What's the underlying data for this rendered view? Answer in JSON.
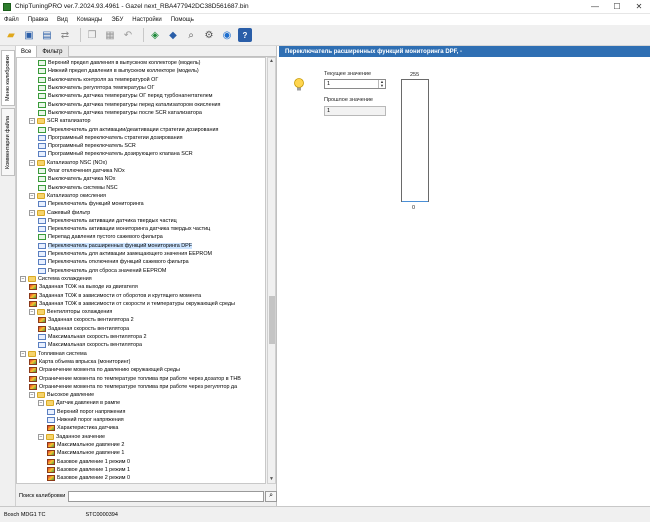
{
  "window": {
    "title": "ChipTuningPRO ver.7.2024.93.4961 - Gazel next_RBA477942DC38D561687.bin",
    "minimize": "—",
    "maximize": "☐",
    "close": "✕"
  },
  "menu": [
    "Файл",
    "Правка",
    "Вид",
    "Команды",
    "ЭБУ",
    "Настройки",
    "Помощь"
  ],
  "side_tabs": {
    "calibrations": "Меню калибровки",
    "comments": "Комментарии файла"
  },
  "left_tabs": [
    "Все",
    "Фильтр"
  ],
  "tree": [
    {
      "level": 2,
      "icon": "check",
      "label": "Верхний предел давления в выпускном коллекторе (модель)"
    },
    {
      "level": 2,
      "icon": "check",
      "label": "Нижний предел давления в выпускном коллекторе (модель)"
    },
    {
      "level": 2,
      "icon": "check",
      "label": "Выключатель контроля за температурой ОГ"
    },
    {
      "level": 2,
      "icon": "check",
      "label": "Выключатель регулятора температуры ОГ"
    },
    {
      "level": 2,
      "icon": "check",
      "label": "Выключатель датчика температуры ОГ перед турбонагнетателем"
    },
    {
      "level": 2,
      "icon": "check",
      "label": "Выключатель датчика температуры перед катализатором окисления"
    },
    {
      "level": 2,
      "icon": "check",
      "label": "Выключатель датчика температуры после SCR катализатора"
    },
    {
      "level": 1,
      "icon": "folder",
      "expander": "−",
      "label": "SCR катализатор"
    },
    {
      "level": 2,
      "icon": "check",
      "label": "Переключатель для активации/деактивации стратегии дозирования"
    },
    {
      "level": 2,
      "icon": "table",
      "label": "Программный переключатель стратегии дозирования"
    },
    {
      "level": 2,
      "icon": "table",
      "label": "Программный переключатель SCR"
    },
    {
      "level": 2,
      "icon": "table",
      "label": "Программный переключатель дозирующего клапана SCR"
    },
    {
      "level": 1,
      "icon": "folder",
      "expander": "−",
      "label": "Катализатор NSC (NOx)"
    },
    {
      "level": 2,
      "icon": "check",
      "label": "Флаг отключения датчика NOx"
    },
    {
      "level": 2,
      "icon": "check",
      "label": "Выключатель датчика NOx"
    },
    {
      "level": 2,
      "icon": "check",
      "label": "Выключатель системы NSC"
    },
    {
      "level": 1,
      "icon": "folder",
      "expander": "−",
      "label": "Катализатор окисления"
    },
    {
      "level": 2,
      "icon": "table",
      "label": "Переключатель функций мониторинга"
    },
    {
      "level": 1,
      "icon": "folder",
      "expander": "−",
      "label": "Сажевый фильтр"
    },
    {
      "level": 2,
      "icon": "table",
      "label": "Переключатель активации датчика твердых частиц"
    },
    {
      "level": 2,
      "icon": "table",
      "label": "Переключатель активации мониторинга датчика твердых частиц"
    },
    {
      "level": 2,
      "icon": "check",
      "label": "Перепад давления пустого сажевого фильтра"
    },
    {
      "level": 2,
      "icon": "table",
      "label": "Переключатель расширенных функций мониторинга DPF",
      "selected": true
    },
    {
      "level": 2,
      "icon": "table",
      "label": "Переключатель для активации замещающего значения EEPROM"
    },
    {
      "level": 2,
      "icon": "table",
      "label": "Переключатель отключения функций сажевого фильтра"
    },
    {
      "level": 2,
      "icon": "table",
      "label": "Переключатель для сброса значений EEPROM"
    },
    {
      "level": 0,
      "icon": "folder",
      "expander": "−",
      "label": "Система охлаждения"
    },
    {
      "level": 1,
      "icon": "map",
      "label": "Заданная ТОЖ на выходе из двигателя"
    },
    {
      "level": 1,
      "icon": "map",
      "label": "Заданная ТОЖ в зависимости от оборотов и крутящего момента"
    },
    {
      "level": 1,
      "icon": "map",
      "label": "Заданная ТОЖ в зависимости от скорости и температуры окружающей среды"
    },
    {
      "level": 1,
      "icon": "folder",
      "expander": "−",
      "label": "Вентиляторы охлаждения"
    },
    {
      "level": 2,
      "icon": "map",
      "label": "Заданная скорость вентилятора 2"
    },
    {
      "level": 2,
      "icon": "map",
      "label": "Заданная скорость вентилятора"
    },
    {
      "level": 2,
      "icon": "table",
      "label": "Максимальная скорость вентилятора 2"
    },
    {
      "level": 2,
      "icon": "table",
      "label": "Максимальная скорость вентилятора"
    },
    {
      "level": 0,
      "icon": "folder",
      "expander": "−",
      "label": "Топливная система"
    },
    {
      "level": 1,
      "icon": "map",
      "label": "Карта объема впрыска (мониторинг)"
    },
    {
      "level": 1,
      "icon": "map",
      "label": "Ограничение момента по давлению окружающей среды"
    },
    {
      "level": 1,
      "icon": "map",
      "label": "Ограничение момента по температуре топлива при работе через дозатор в ТНВ"
    },
    {
      "level": 1,
      "icon": "map",
      "label": "Ограничение момента по температуре топлива при работе через регулятор да"
    },
    {
      "level": 1,
      "icon": "folder",
      "expander": "−",
      "label": "Высокое давление"
    },
    {
      "level": 2,
      "icon": "folder",
      "expander": "−",
      "label": "Датчик давления в рампе"
    },
    {
      "level": 3,
      "icon": "table",
      "label": "Верхний порог напряжения"
    },
    {
      "level": 3,
      "icon": "table",
      "label": "Нижний порог напряжения"
    },
    {
      "level": 3,
      "icon": "map",
      "label": "Характеристика датчика"
    },
    {
      "level": 2,
      "icon": "folder",
      "expander": "−",
      "label": "Заданное значение"
    },
    {
      "level": 3,
      "icon": "map",
      "label": "Максимальное давление 2"
    },
    {
      "level": 3,
      "icon": "map",
      "label": "Максимальное давление 1"
    },
    {
      "level": 3,
      "icon": "map",
      "label": "Базовое давление 1 режим 0"
    },
    {
      "level": 3,
      "icon": "map",
      "label": "Базовое давление 1 режим 1"
    },
    {
      "level": 3,
      "icon": "map",
      "label": "Базовое давление 2 режим 0"
    }
  ],
  "search": {
    "label": "Поиск калибровки",
    "value": "",
    "button_icon": "search-icon"
  },
  "editor": {
    "header": "Переключатель расширенных функций мониторинга DPF, -",
    "current_label": "Текущее значение",
    "current_value": "1",
    "previous_label": "Прошлое значение",
    "previous_value": "1",
    "gauge_max": "255",
    "gauge_min": "0",
    "gauge_level": 0.0039
  },
  "status": {
    "ecu": "Bosch MDG1 TC",
    "id": "STC0000394"
  },
  "colors": {
    "header_bg": "#2f6fb3",
    "selected_bg": "#cce4ff"
  }
}
